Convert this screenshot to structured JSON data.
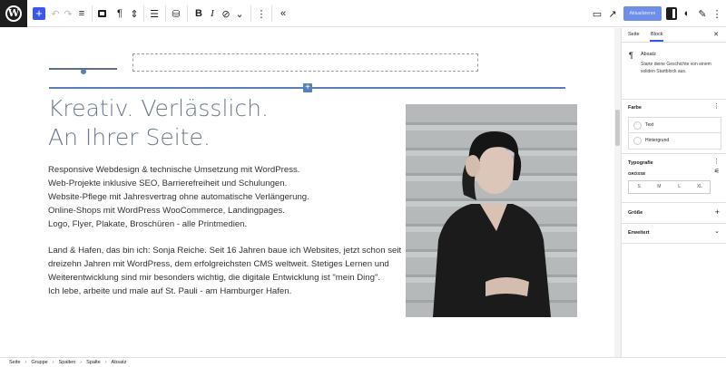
{
  "toolbar": {
    "wp_logo": "W",
    "add_icon": "+",
    "undo_icon": "↶",
    "redo_icon": "↷",
    "list_icon": "≡",
    "paragraph_icon": "¶",
    "move_icon": "⇕",
    "align_icon": "☰",
    "db_icon": "⛁",
    "bold_label": "B",
    "italic_label": "I",
    "link_icon": "⊘",
    "more_icon": "⌄",
    "options_icon": "⋮",
    "collapse_icon": "«",
    "desktop_icon": "▭",
    "external_icon": "↗",
    "update_label": "Aktualisieren",
    "styles_icon": "◐",
    "edit_icon": "✎"
  },
  "canvas": {
    "heading": [
      "Kreativ. Verlässlich.",
      "An Ihrer Seite."
    ],
    "paragraph1": [
      "Responsive Webdesign & technische Umsetzung mit WordPress.",
      "Web-Projekte inklusive SEO, Barrierefreiheit und Schulungen.",
      "Website-Pflege mit Jahresvertrag ohne automatische Verlängerung.",
      "Online-Shops mit WordPress WooCommerce, Landingpages.",
      "Logo, Flyer, Plakate, Broschüren - alle Printmedien."
    ],
    "paragraph2": [
      "Land & Hafen, das bin ich: Sonja Reiche. Seit 16 Jahren baue ich Websites, jetzt schon seit",
      "dreizehn Jahren mit WordPress, dem erfolgreichsten CMS weltweit. Stetiges Lernen und",
      "Weiterentwicklung sind mir besonders wichtig, die digitale Entwicklung ist \"mein Ding\".",
      "Ich lebe, arbeite und male auf St. Pauli - am Hamburger Hafen."
    ],
    "inserter_icon": "+"
  },
  "sidebar": {
    "tab_page": "Seite",
    "tab_block": "Block",
    "close_icon": "✕",
    "block_icon": "¶",
    "block_name": "Absatz",
    "block_desc": "Starte deine Geschichte von einem soliden Startblock aus.",
    "color_title": "Farbe",
    "color_text": "Text",
    "color_bg": "Hintergrund",
    "typo_title": "Typografie",
    "size_label": "GRÖSSE",
    "sizes": [
      "S",
      "M",
      "L",
      "XL"
    ],
    "size_ctrl_icon": "⚟",
    "dims_title": "Größe",
    "dims_add": "+",
    "advanced_title": "Erweitert",
    "advanced_icon": "⌄",
    "menu_icon": "⋮"
  },
  "breadcrumb": [
    "Seite",
    "Gruppe",
    "Spalten",
    "Spalte",
    "Absatz"
  ],
  "breadcrumb_sep": "›",
  "colors": {
    "accent": "#3858e9",
    "selection": "#5a7fb8",
    "heading": "#6b7a8f"
  }
}
